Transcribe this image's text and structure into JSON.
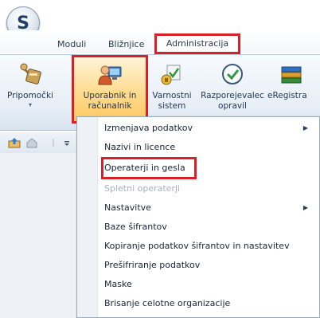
{
  "app": {
    "orb_letter": "S"
  },
  "tabs": [
    {
      "label": "Moduli"
    },
    {
      "label": "Bližnjice"
    },
    {
      "label": "Administracija"
    }
  ],
  "ribbon": {
    "buttons": [
      {
        "label1": "Pripomočki",
        "label2": "",
        "arrow": "▾"
      },
      {
        "label1": "Uporabnik in",
        "label2": "računalnik",
        "arrow": "▾"
      },
      {
        "label1": "Varnostni",
        "label2": "sistem",
        "arrow": "▾"
      },
      {
        "label1": "Razporejevalec",
        "label2": "opravil",
        "arrow": "▾"
      },
      {
        "label1": "eRegistra",
        "label2": "",
        "arrow": ""
      }
    ]
  },
  "menu": {
    "items": [
      {
        "label": "Izmenjava podatkov",
        "disabled": false,
        "submenu": true
      },
      {
        "label": "Nazivi in licence",
        "disabled": false,
        "submenu": false
      },
      {
        "label": "Operaterji in gesla",
        "disabled": false,
        "submenu": false
      },
      {
        "label": "Spletni operaterji",
        "disabled": true,
        "submenu": false
      },
      {
        "label": "Nastavitve",
        "disabled": false,
        "submenu": true
      },
      {
        "label": "Baze šifrantov",
        "disabled": false,
        "submenu": false
      },
      {
        "label": "Kopiranje podatkov šifrantov in nastavitev",
        "disabled": false,
        "submenu": false
      },
      {
        "label": "Prešifriranje podatkov",
        "disabled": false,
        "submenu": false
      },
      {
        "label": "Maske",
        "disabled": false,
        "submenu": false
      },
      {
        "label": "Brisanje celotne organizacije",
        "disabled": false,
        "submenu": false
      }
    ],
    "submenu_arrow": "▶"
  },
  "colors": {
    "highlight_border": "#d9202a",
    "ribbon_bg": "#e6eef6",
    "selected_button_bg": "#ffd98a"
  }
}
